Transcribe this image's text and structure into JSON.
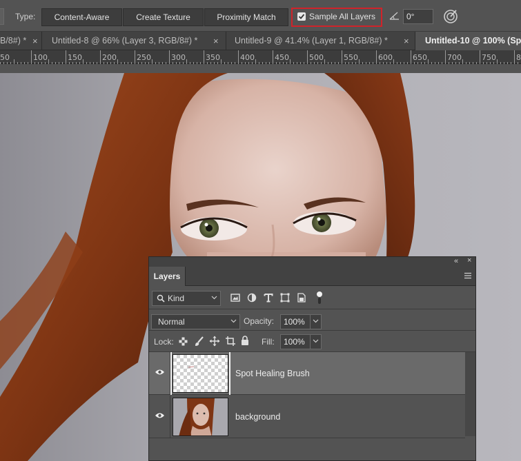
{
  "options_bar": {
    "type_label": "Type:",
    "type_buttons": [
      "Content-Aware",
      "Create Texture",
      "Proximity Match"
    ],
    "sample_all_layers": {
      "label": "Sample All Layers",
      "checked": true
    },
    "angle_value": "0°",
    "highlight_color": "#d0232a"
  },
  "tabs": [
    {
      "label": "B/8#) *",
      "close": "×"
    },
    {
      "label": "Untitled-8 @ 66% (Layer 3, RGB/8#) *",
      "close": "×"
    },
    {
      "label": "Untitled-9 @ 41.4% (Layer 1, RGB/8#) *",
      "close": "×"
    },
    {
      "label": "Untitled-10 @ 100% (Sp",
      "active": true
    }
  ],
  "ruler": {
    "ticks": [
      "50",
      "100",
      "150",
      "200",
      "250",
      "300",
      "350",
      "400",
      "450",
      "500",
      "550",
      "600",
      "650",
      "700",
      "750",
      "80"
    ]
  },
  "layers_panel": {
    "collapse": "«",
    "close": "×",
    "tab_label": "Layers",
    "filter": {
      "kind_label": "Kind"
    },
    "blend_mode": "Normal",
    "opacity_label": "Opacity:",
    "opacity_value": "100%",
    "lock_label": "Lock:",
    "fill_label": "Fill:",
    "fill_value": "100%",
    "layers": [
      {
        "name": "Spot Healing Brush",
        "selected": true,
        "visible": true
      },
      {
        "name": "background",
        "selected": false,
        "visible": true
      }
    ]
  }
}
